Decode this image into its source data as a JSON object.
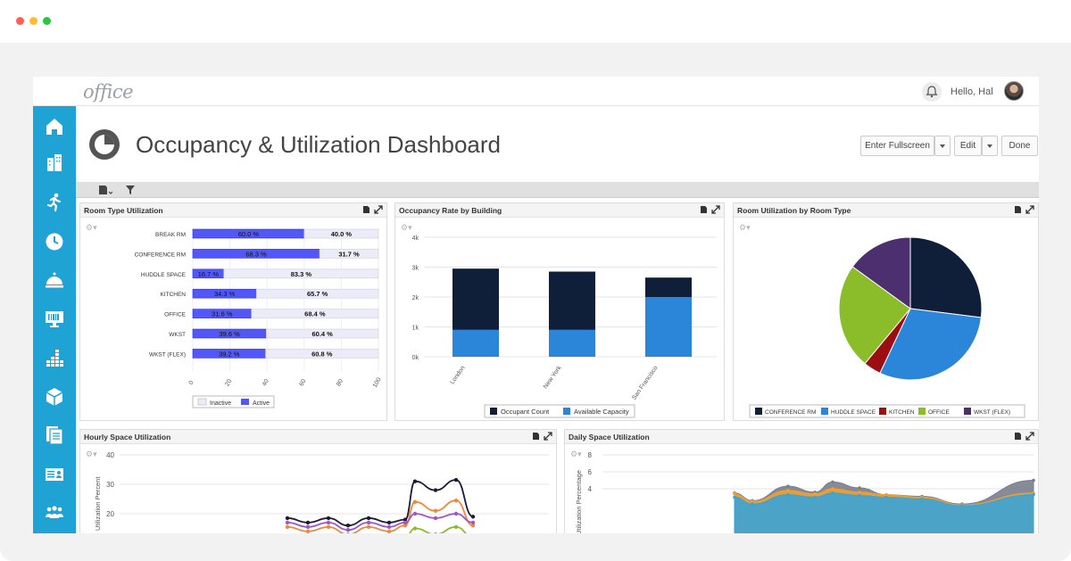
{
  "app": {
    "logo": "office",
    "greeting": "Hello, Hal",
    "page_title": "Occupancy & Utilization Dashboard"
  },
  "buttons": {
    "fullscreen": "Enter Fullscreen",
    "edit": "Edit",
    "done": "Done"
  },
  "colors": {
    "sidebar": "#1fa2d4",
    "navy": "#0f1f3a",
    "blue": "#2b86d9",
    "active": "#5257f5",
    "inactive": "#ecebf8"
  },
  "sidebar": {
    "items": [
      "home-icon",
      "building-icon",
      "person-run-icon",
      "clock-icon",
      "service-bell-icon",
      "monitor-icon",
      "bar-chart-icon",
      "box-icon",
      "documents-icon",
      "id-card-icon",
      "people-icon"
    ]
  },
  "panels": {
    "room_type": {
      "title": "Room Type Utilization",
      "legend_inactive": "Inactive",
      "legend_active": "Active"
    },
    "occupancy": {
      "title": "Occupancy Rate by Building",
      "legend_a": "Occupant Count",
      "legend_b": "Available Capacity"
    },
    "room_util": {
      "title": "Room Utilization by Room Type"
    },
    "hourly": {
      "title": "Hourly Space Utilization",
      "ylabel": "Utilization Percent"
    },
    "daily": {
      "title": "Daily Space Utilization",
      "ylabel": "Utilization Percentage"
    }
  },
  "chart_data": [
    {
      "type": "bar",
      "orientation": "horizontal",
      "stacked": true,
      "categories": [
        "BREAK RM",
        "CONFERENCE RM",
        "HUDDLE SPACE",
        "KITCHEN",
        "OFFICE",
        "WKST",
        "WKST (FLEX)"
      ],
      "series": [
        {
          "name": "Active",
          "values": [
            60.0,
            68.3,
            16.7,
            34.3,
            31.6,
            39.6,
            39.2
          ],
          "labels": [
            "60.0 %",
            "68.3 %",
            "16.7 %",
            "34.3 %",
            "31.6 %",
            "39.6 %",
            "39.2 %"
          ]
        },
        {
          "name": "Inactive",
          "values": [
            40.0,
            31.7,
            83.3,
            65.7,
            68.4,
            60.4,
            60.8
          ],
          "labels": [
            "40.0 %",
            "31.7 %",
            "83.3 %",
            "65.7 %",
            "68.4 %",
            "60.4 %",
            "60.8 %"
          ]
        }
      ],
      "xticks": [
        "0",
        "20",
        "40",
        "60",
        "80",
        "100"
      ],
      "xlim": [
        0,
        100
      ]
    },
    {
      "type": "bar",
      "stacked": true,
      "categories": [
        "London",
        "New York",
        "San Francisco"
      ],
      "series": [
        {
          "name": "Available Capacity",
          "values": [
            900,
            900,
            2000
          ]
        },
        {
          "name": "Occupant Count",
          "values": [
            2050,
            1950,
            650
          ]
        }
      ],
      "yticks": [
        "0k",
        "1k",
        "2k",
        "3k",
        "4k"
      ],
      "ylim": [
        0,
        4000
      ]
    },
    {
      "type": "pie",
      "labels": [
        "CONFERENCE RM",
        "HUDDLE SPACE",
        "KITCHEN",
        "OFFICE",
        "WKST (FLEX)"
      ],
      "values": [
        27,
        30,
        4,
        24,
        15
      ],
      "colors": [
        "#0f1f3a",
        "#2b86d9",
        "#9b0f12",
        "#8bbd2b",
        "#4b2f6e"
      ]
    },
    {
      "type": "line",
      "yticks": [
        "20",
        "30",
        "40"
      ],
      "ylabel": "Utilization Percent",
      "series": [
        {
          "color": "#1c1c3a",
          "values": [
            18.5,
            17,
            18.5,
            16,
            18.5,
            17,
            18,
            31,
            28,
            31.5,
            19
          ]
        },
        {
          "color": "#f0883a",
          "values": [
            15.5,
            14,
            15.5,
            13,
            15.5,
            14,
            16,
            24,
            21,
            24.5,
            16
          ]
        },
        {
          "color": "#a055c8",
          "values": [
            17,
            15.5,
            17,
            14.5,
            17,
            15.5,
            17,
            20,
            18.5,
            20,
            17
          ]
        },
        {
          "color": "#8bbd2b",
          "values": [
            12,
            11,
            12,
            10,
            12,
            11,
            12,
            15,
            13,
            15.5,
            12
          ]
        }
      ]
    },
    {
      "type": "area",
      "yticks": [
        "4",
        "6",
        "8"
      ],
      "ylabel": "Utilization Percentage",
      "series": [
        {
          "color": "#7a7d8c",
          "values": [
            3.5,
            2.6,
            4.3,
            3.6,
            4.8,
            4.1,
            3.3,
            3.1,
            2.2,
            5.0
          ]
        },
        {
          "color": "#f0a030",
          "values": [
            3.4,
            2.5,
            3.8,
            3.4,
            4.0,
            3.6,
            3.3,
            3.0,
            2.1,
            3.5
          ]
        },
        {
          "color": "#3aa3d8",
          "values": [
            3.0,
            2.2,
            3.3,
            3.0,
            3.5,
            3.2,
            3.0,
            2.8,
            2.0,
            3.3
          ]
        }
      ]
    }
  ]
}
